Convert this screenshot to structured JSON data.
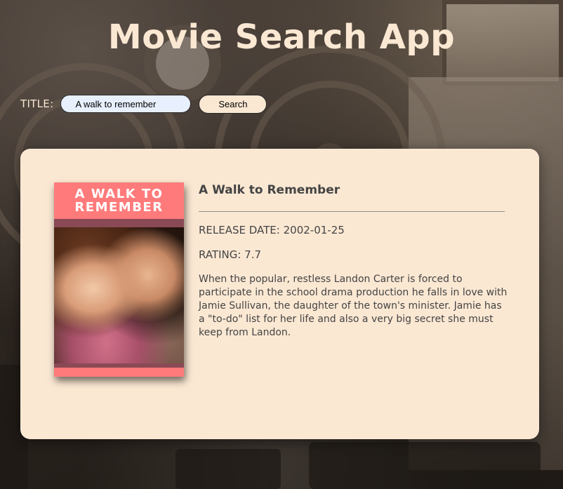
{
  "header": {
    "title": "Movie Search App"
  },
  "search": {
    "label": "TITLE:",
    "value": "A walk to remember",
    "button_label": "Search"
  },
  "result": {
    "poster_title": "A WALK TO\nREMEMBER",
    "title": "A Walk to Remember",
    "release_date": "RELEASE DATE: 2002-01-25",
    "rating": "RATING: 7.7",
    "plot": "When the popular, restless Landon Carter is forced to participate in the school drama production he falls in love with Jamie Sullivan, the daughter of the town's minister. Jamie has a \"to-do\" list for her life and also a very big secret she must keep from Landon."
  },
  "colors": {
    "accent": "#fbe8d3",
    "input_background": "#e8f0fe",
    "text": "#444444",
    "poster_pink": "#ff7a7a"
  }
}
